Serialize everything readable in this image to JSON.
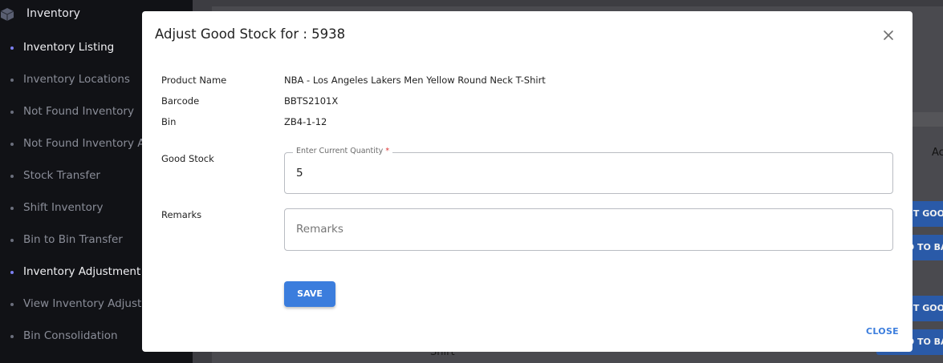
{
  "sidebar": {
    "title": "Inventory",
    "items": [
      {
        "label": "Inventory Listing",
        "active": true
      },
      {
        "label": "Inventory Locations",
        "active": false
      },
      {
        "label": "Not Found Inventory",
        "active": false
      },
      {
        "label": "Not Found Inventory Ar",
        "active": false
      },
      {
        "label": "Stock Transfer",
        "active": false
      },
      {
        "label": "Shift Inventory",
        "active": false
      },
      {
        "label": "Bin to Bin Transfer",
        "active": false
      },
      {
        "label": "Inventory Adjustment",
        "active": true
      },
      {
        "label": "View Inventory Adjustm",
        "active": false
      },
      {
        "label": "Bin Consolidation",
        "active": false
      }
    ]
  },
  "background": {
    "header_partial": "Ac",
    "button_adjust": "ST GOO",
    "button_add": "D TO BA",
    "cell_text": "Shirt"
  },
  "modal": {
    "title": "Adjust Good Stock for : 5938",
    "product_name_label": "Product Name",
    "product_name_value": "NBA - Los Angeles Lakers Men Yellow Round Neck T-Shirt",
    "barcode_label": "Barcode",
    "barcode_value": "BBTS2101X",
    "bin_label": "Bin",
    "bin_value": "ZB4-1-12",
    "good_stock_label": "Good Stock",
    "quantity_legend": "Enter Current Quantity",
    "quantity_required_mark": "*",
    "quantity_value": "5",
    "remarks_label": "Remarks",
    "remarks_placeholder": "Remarks",
    "save_label": "SAVE",
    "close_label": "CLOSE"
  },
  "colors": {
    "accent": "#3b7ddd",
    "sidebar_bg": "#111216",
    "active_dot": "#7c7ff0"
  }
}
